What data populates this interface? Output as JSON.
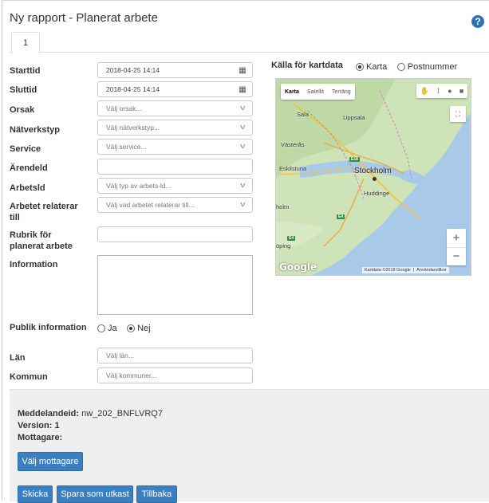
{
  "header": {
    "title": "Ny rapport - Planerat arbete",
    "help_icon": "?",
    "tab_label": "1"
  },
  "form": {
    "starttid": {
      "label": "Starttid",
      "value": "2018-04-25 14:14"
    },
    "sluttid": {
      "label": "Sluttid",
      "value": "2018-04-25 14:14"
    },
    "orsak": {
      "label": "Orsak",
      "placeholder": "Välj orsak..."
    },
    "natverkstyp": {
      "label": "Nätverkstyp",
      "placeholder": "Välj nätverkstyp..."
    },
    "service": {
      "label": "Service",
      "placeholder": "Välj service..."
    },
    "arendeid": {
      "label": "Ärendeld",
      "value": ""
    },
    "arbetsid": {
      "label": "Arbetsld",
      "placeholder": "Välj typ av arbets-ld..."
    },
    "relaterar": {
      "label_line1": "Arbetet relaterar",
      "label_line2": "till",
      "placeholder": "Välj vad arbetet relaterar till..."
    },
    "rubrik": {
      "label_line1": "Rubrik för",
      "label_line2": "planerat arbete",
      "value": ""
    },
    "information": {
      "label": "Information",
      "value": ""
    },
    "publik": {
      "label": "Publik information",
      "option_yes": "Ja",
      "option_no": "Nej",
      "selected": "Nej"
    },
    "lan": {
      "label": "Län",
      "placeholder": "Välj län..."
    },
    "kommun": {
      "label": "Kommun",
      "placeholder": "Välj kommuner..."
    }
  },
  "map": {
    "heading": "Källa för kartdata",
    "option_karta": "Karta",
    "option_postnummer": "Postnummer",
    "selected": "Karta",
    "type_karta": "Karta",
    "type_satellit": "Satellit",
    "type_terrang": "Terräng",
    "places": {
      "sala": "Sala",
      "uppsala": "Uppsala",
      "vasteras": "Västerås",
      "eskilstuna": "Eskilstuna",
      "stockholm": "Stockholm",
      "huddinge": "Huddinge",
      "holm": "holm",
      "oping": "öping"
    },
    "roads": {
      "e18": "E18",
      "e4a": "E4",
      "e4b": "E4"
    },
    "google_logo": "Google",
    "footer_data": "Kartdata ©2018 Google",
    "footer_terms": "Användarvillkor",
    "zoom_in": "+",
    "zoom_out": "−"
  },
  "bottom": {
    "meddelande_label": "Meddelandeid:",
    "meddelande_value": "nw_202_BNFLVRQ7",
    "version_label": "Version:",
    "version_value": "1",
    "mottagare_label": "Mottagare:",
    "valj_mottagare": "Välj mottagare",
    "skicka": "Skicka",
    "spara": "Spara som utkast",
    "tillbaka": "Tillbaka"
  },
  "colors": {
    "primary_button": "#3a7fc1",
    "help_icon": "#2f72b8",
    "water": "#a9c9e8",
    "land": "#cfe3b8"
  }
}
